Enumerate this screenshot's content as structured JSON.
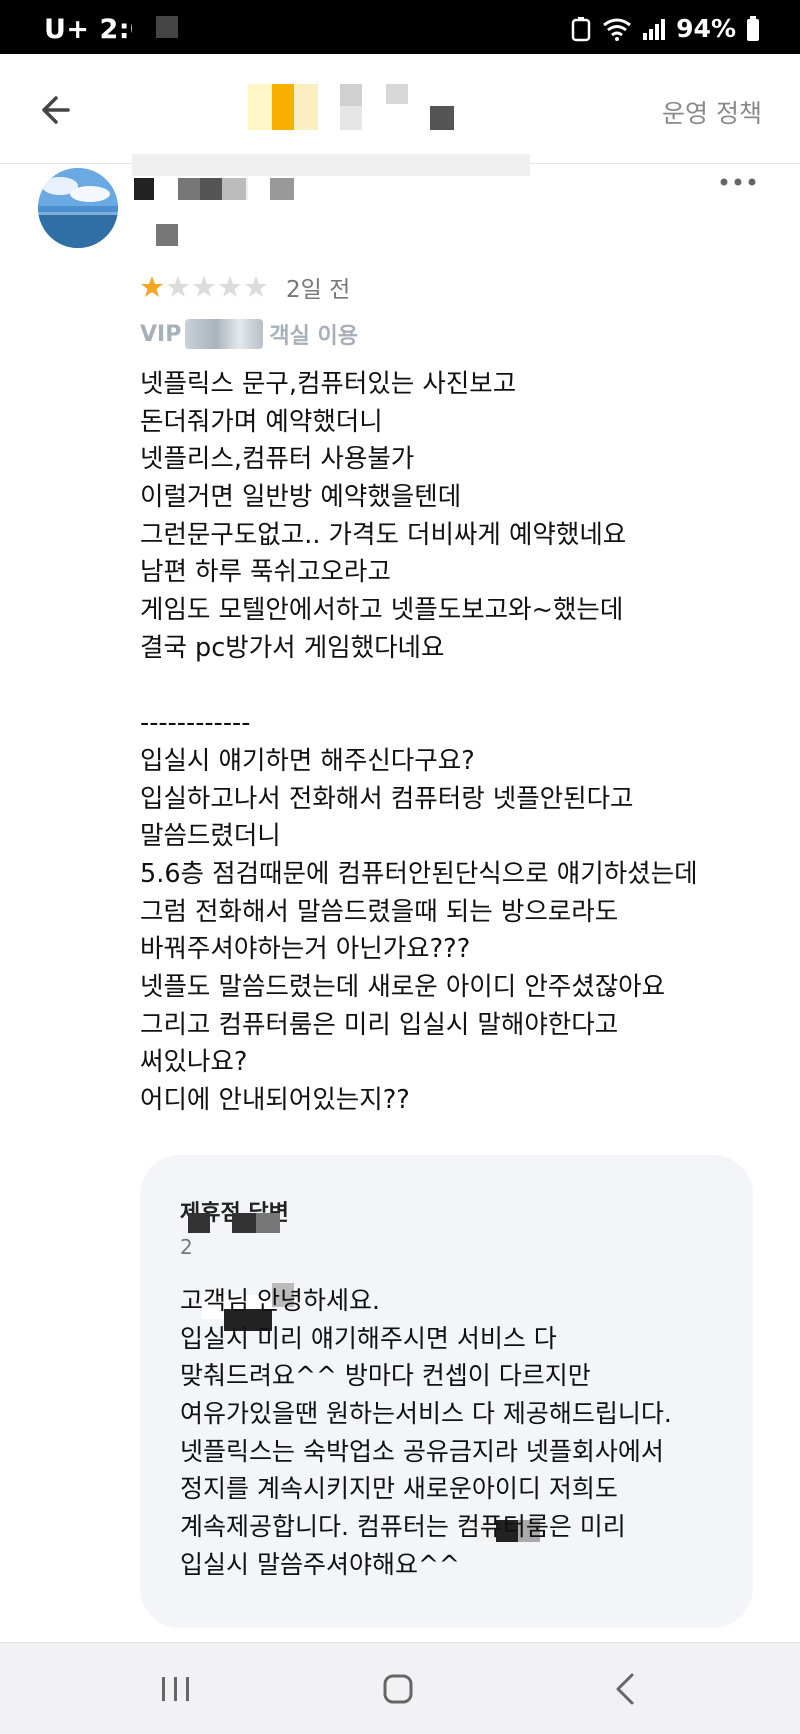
{
  "status_bar": {
    "carrier": "U+ 2:06",
    "battery": "94%"
  },
  "header": {
    "policy_link": "운영 정책"
  },
  "review": {
    "rating": 1,
    "max_rating": 5,
    "date": "2일 전",
    "room_prefix": "VIP",
    "room_suffix": "객실 이용",
    "body_lines": [
      "넷플릭스 문구,컴퓨터있는 사진보고",
      "돈더줘가며 예약했더니",
      "넷플리스,컴퓨터 사용불가",
      "이럴거면 일반방 예약했을텐데",
      "그런문구도없고.. 가격도 더비싸게 예약했네요",
      "남편 하루 푹쉬고오라고",
      "게임도 모텔안에서하고 넷플도보고와~했는데",
      "결국 pc방가서 게임했다네요",
      "",
      "------------",
      "입실시 얘기하면 해주신다구요?",
      "입실하고나서 전화해서 컴퓨터랑 넷플안된다고",
      "말씀드렸더니",
      "5.6층 점검때문에 컴퓨터안된단식으로 얘기하셨는데",
      "그럼 전화해서 말씀드렸을때 되는 방으로라도",
      "바꿔주셔야하는거 아닌가요???",
      "넷플도 말씀드렸는데 새로운 아이디 안주셨잖아요",
      "그리고 컴퓨터룸은 미리 입실시 말해야한다고",
      "써있나요?",
      "어디에 안내되어있는지??"
    ]
  },
  "reply": {
    "title": "제휴점 답변",
    "date": "2",
    "body_lines": [
      "고객님 안녕하세요.",
      "입실시 미리 얘기해주시면 서비스 다",
      "맞춰드려요^^ 방마다 컨셉이 다르지만",
      "여유가있을땐 원하는서비스 다 제공해드립니다.",
      "넷플릭스는 숙박업소 공유금지라 넷플회사에서",
      "정지를 계속시키지만 새로운아이디 저희도",
      "계속제공합니다. 컴퓨터는 컴퓨터룸은 미리",
      "입실시 말씀주셔야해요^^"
    ]
  },
  "icons": {
    "back": "arrow-left-icon",
    "more": "more-dots-icon",
    "star_filled_color": "#f5a623",
    "star_empty_color": "#dcdcdc"
  }
}
